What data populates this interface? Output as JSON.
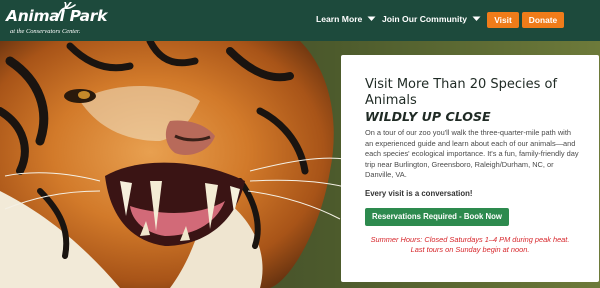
{
  "header": {
    "logo_main": "Animal Park",
    "logo_sub": "at the Conservators Center.",
    "menu": [
      {
        "label": "Learn More"
      },
      {
        "label": "Join Our Community"
      }
    ],
    "visit_label": "Visit",
    "donate_label": "Donate"
  },
  "hero": {
    "title": "Visit More Than 20 Species of Animals",
    "subtitle": "WILDLY UP CLOSE",
    "body": "On a tour of our zoo you'll walk the three-quarter-mile path with an experienced guide and learn about each of our animals—and each species' ecological importance. It's a fun, family-friendly day trip near Burlington, Greensboro, Raleigh/Durham, NC, or Danville, VA.",
    "bold_line": "Every visit is a conversation!",
    "cta_label": "Reservations Required - Book Now",
    "note": "Summer Hours: Closed Saturdays 1–4 PM during peak heat. Last tours on Sunday begin at noon."
  },
  "colors": {
    "header_bg": "#1d4a3c",
    "accent_orange": "#f07c1a",
    "cta_green": "#2d8a4e",
    "note_red": "#d7262b"
  }
}
